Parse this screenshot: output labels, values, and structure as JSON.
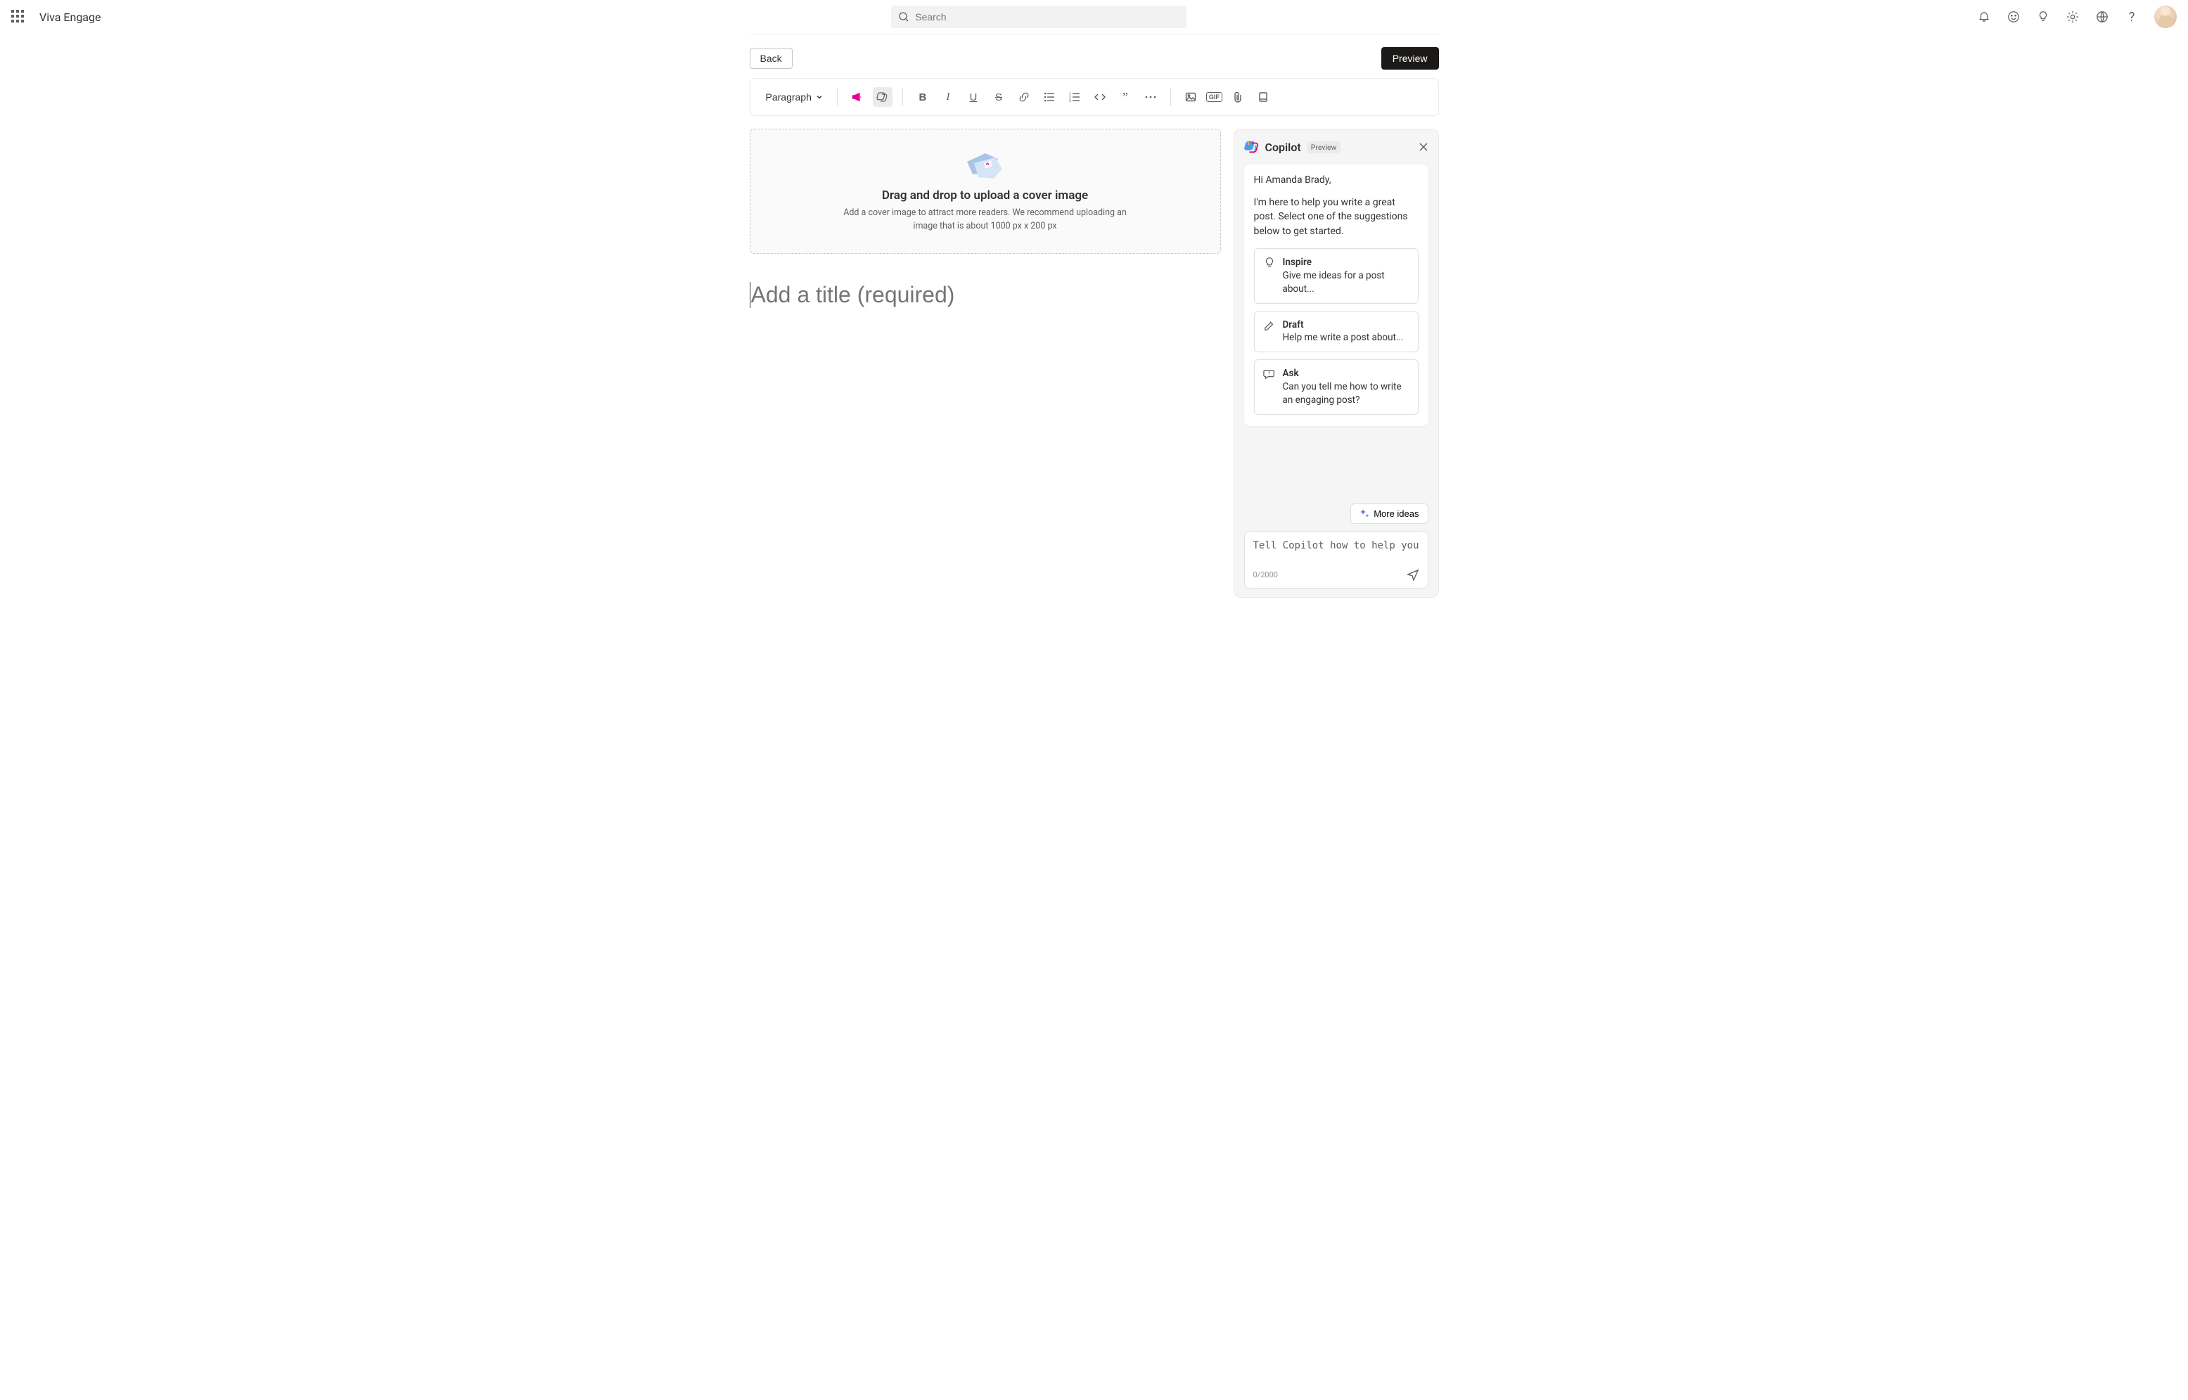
{
  "header": {
    "brand": "Viva Engage",
    "search_placeholder": "Search"
  },
  "actions": {
    "back": "Back",
    "preview": "Preview"
  },
  "toolbar": {
    "paragraph": "Paragraph"
  },
  "dropzone": {
    "title": "Drag and drop to upload a cover image",
    "subtitle": "Add a cover image to attract more readers. We recommend uploading an image that is about 1000 px x 200 px"
  },
  "editor": {
    "title_placeholder": "Add a title (required)"
  },
  "copilot": {
    "title": "Copilot",
    "badge": "Preview",
    "greeting": "Hi Amanda Brady,",
    "intro": "I'm here to help you write a great post. Select one of the suggestions below to get started.",
    "suggestions": {
      "inspire": {
        "title": "Inspire",
        "desc": "Give me ideas for a post about..."
      },
      "draft": {
        "title": "Draft",
        "desc": "Help me write a post about..."
      },
      "ask": {
        "title": "Ask",
        "desc": "Can you tell me how to write an engaging post?"
      }
    },
    "more_ideas": "More ideas",
    "input_placeholder": "Tell Copilot how to help you",
    "char_count": "0/2000"
  }
}
